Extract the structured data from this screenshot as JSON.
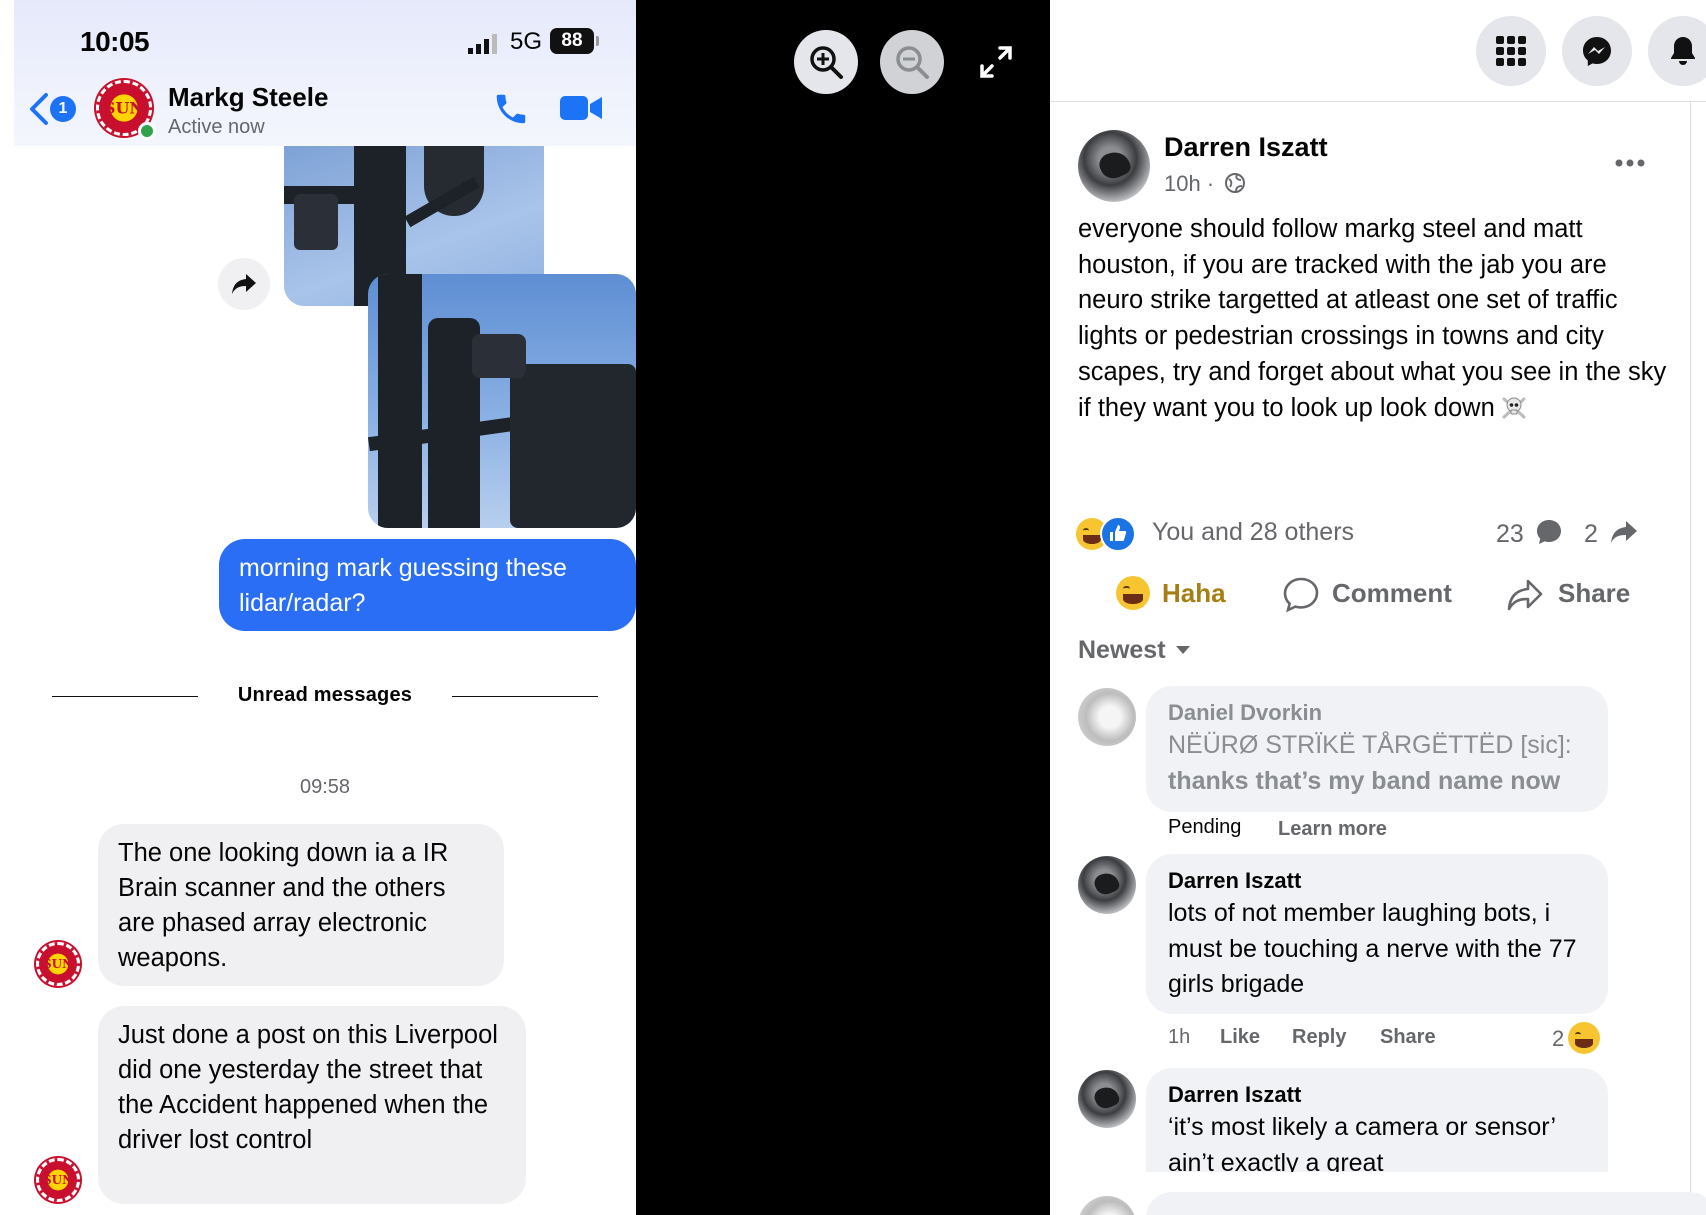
{
  "messenger": {
    "status_bar": {
      "time": "10:05",
      "network": "5G",
      "battery": "88"
    },
    "header": {
      "back_badge": "1",
      "avatar_text": "SUN",
      "contact_name": "Markg Steele",
      "contact_status": "Active now"
    },
    "outgoing_message": "morning mark guessing these lidar/radar?",
    "divider_label": "Unread messages",
    "timestamp": "09:58",
    "incoming_messages": [
      "The one looking down ia a IR Brain scanner  and the others are phased array electronic weapons.",
      "Just done a post on this Liverpool did one yesterday the street that the Accident happened when the driver lost control"
    ]
  },
  "viewer": {
    "icons": [
      "zoom-in-icon",
      "zoom-out-icon",
      "fullscreen-icon"
    ]
  },
  "facebook": {
    "top_icons": [
      "menu-grid-icon",
      "messenger-icon",
      "bell-icon"
    ],
    "post": {
      "author": "Darren Iszatt",
      "time": "10h · ",
      "text": "everyone should follow markg steel and matt houston, if you are tracked with the jab you are neuro strike targetted at atleast one set of traffic lights or pedestrian crossings in towns and city scapes, try and forget about what you see in the sky if they want you to look up look down",
      "reactions_summary": "You and 28 others",
      "comment_count": "23",
      "share_count": "2"
    },
    "actions": {
      "reaction_label": "Haha",
      "comment_label": "Comment",
      "share_label": "Share"
    },
    "sort_label": "Newest",
    "comments": [
      {
        "author": "Daniel Dvorkin",
        "text_line1": "NËÜRØ STRÏKË TÅRGËTTËD [sic]:",
        "text_line2": "thanks that’s my band name now",
        "meta_status": "Pending",
        "meta_link": "Learn more"
      },
      {
        "author": "Darren Iszatt",
        "text": "lots of not member laughing bots, i must be touching a nerve with the 77 girls brigade",
        "time": "1h",
        "like": "Like",
        "reply": "Reply",
        "share": "Share",
        "reaction_count": "2"
      },
      {
        "author": "Darren Iszatt",
        "text": "‘it’s most likely a camera or sensor’ ain’t exactly a great"
      }
    ],
    "colors": {
      "messenger_blue": "#2a6ef5",
      "fb_blue": "#1b74e4",
      "haha_gold": "#a77e14"
    }
  }
}
